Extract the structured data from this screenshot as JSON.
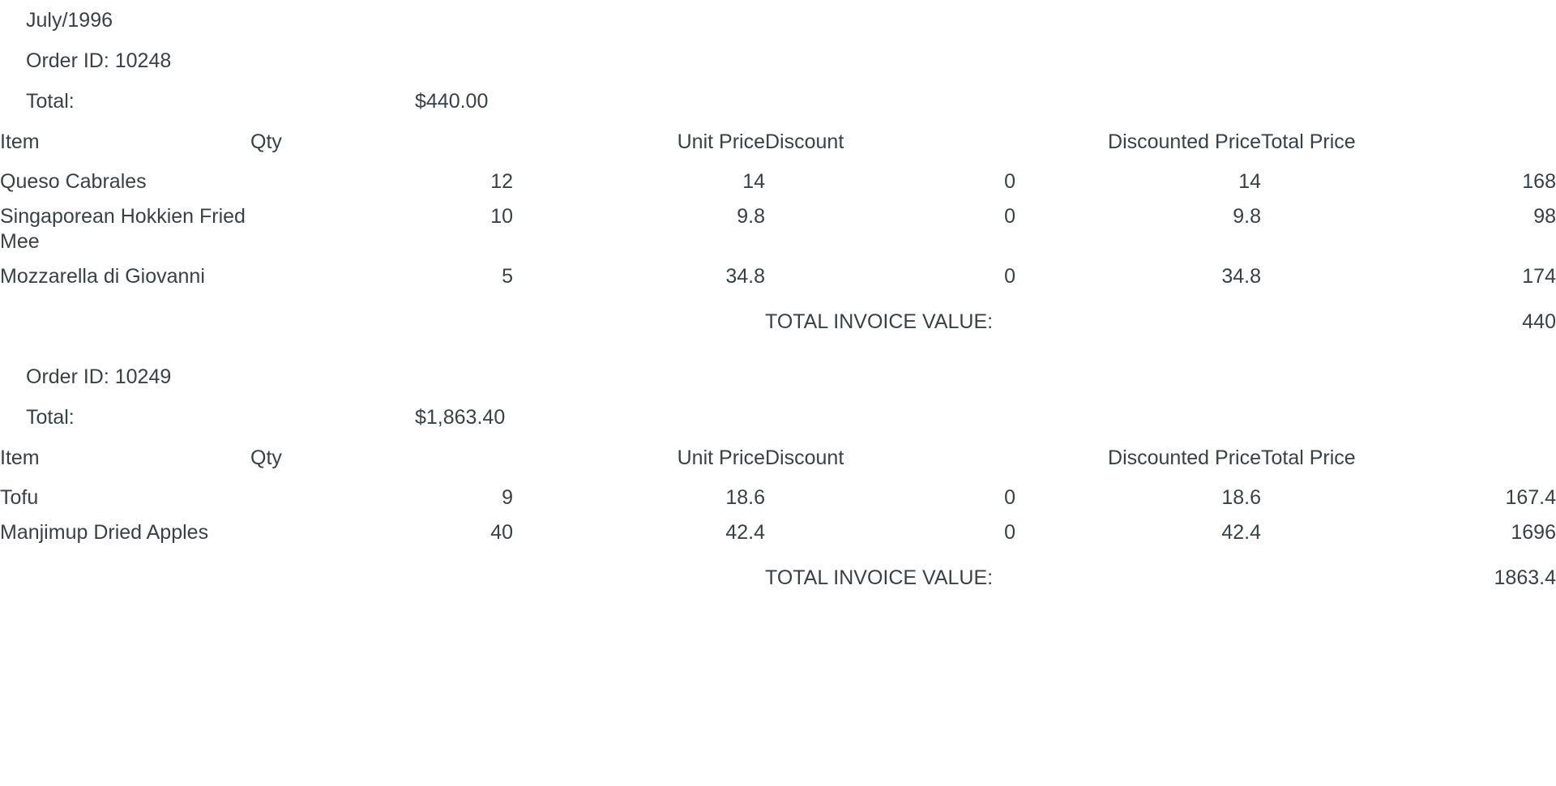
{
  "report": {
    "period": "July/1996"
  },
  "labels": {
    "order_id_prefix": "Order ID:",
    "total_label": "Total:",
    "grand_total_label": "TOTAL INVOICE VALUE:"
  },
  "columns": {
    "item": "Item",
    "qty": "Qty",
    "unit_price": "Unit Price",
    "discount": "Discount",
    "discounted_price": "Discounted Price",
    "total_price": "Total Price"
  },
  "orders": [
    {
      "order_id_line": "Order ID: 10248",
      "total_label": "Total:",
      "total_value": "$440.00",
      "grand_total_label": "TOTAL INVOICE VALUE:",
      "grand_total_value": "440",
      "rows": [
        {
          "item": "Queso Cabrales",
          "qty": "12",
          "unit_price": "14",
          "discount": "0",
          "discounted_price": "14",
          "total_price": "168"
        },
        {
          "item": "Singaporean Hokkien Fried Mee",
          "qty": "10",
          "unit_price": "9.8",
          "discount": "0",
          "discounted_price": "9.8",
          "total_price": "98"
        },
        {
          "item": "Mozzarella di Giovanni",
          "qty": "5",
          "unit_price": "34.8",
          "discount": "0",
          "discounted_price": "34.8",
          "total_price": "174"
        }
      ]
    },
    {
      "order_id_line": "Order ID: 10249",
      "total_label": "Total:",
      "total_value": "$1,863.40",
      "grand_total_label": "TOTAL INVOICE VALUE:",
      "grand_total_value": "1863.4",
      "rows": [
        {
          "item": "Tofu",
          "qty": "9",
          "unit_price": "18.6",
          "discount": "0",
          "discounted_price": "18.6",
          "total_price": "167.4"
        },
        {
          "item": "Manjimup Dried Apples",
          "qty": "40",
          "unit_price": "42.4",
          "discount": "0",
          "discounted_price": "42.4",
          "total_price": "1696"
        }
      ]
    }
  ],
  "colors": {
    "text": "#3c4043",
    "background": "#ffffff"
  }
}
